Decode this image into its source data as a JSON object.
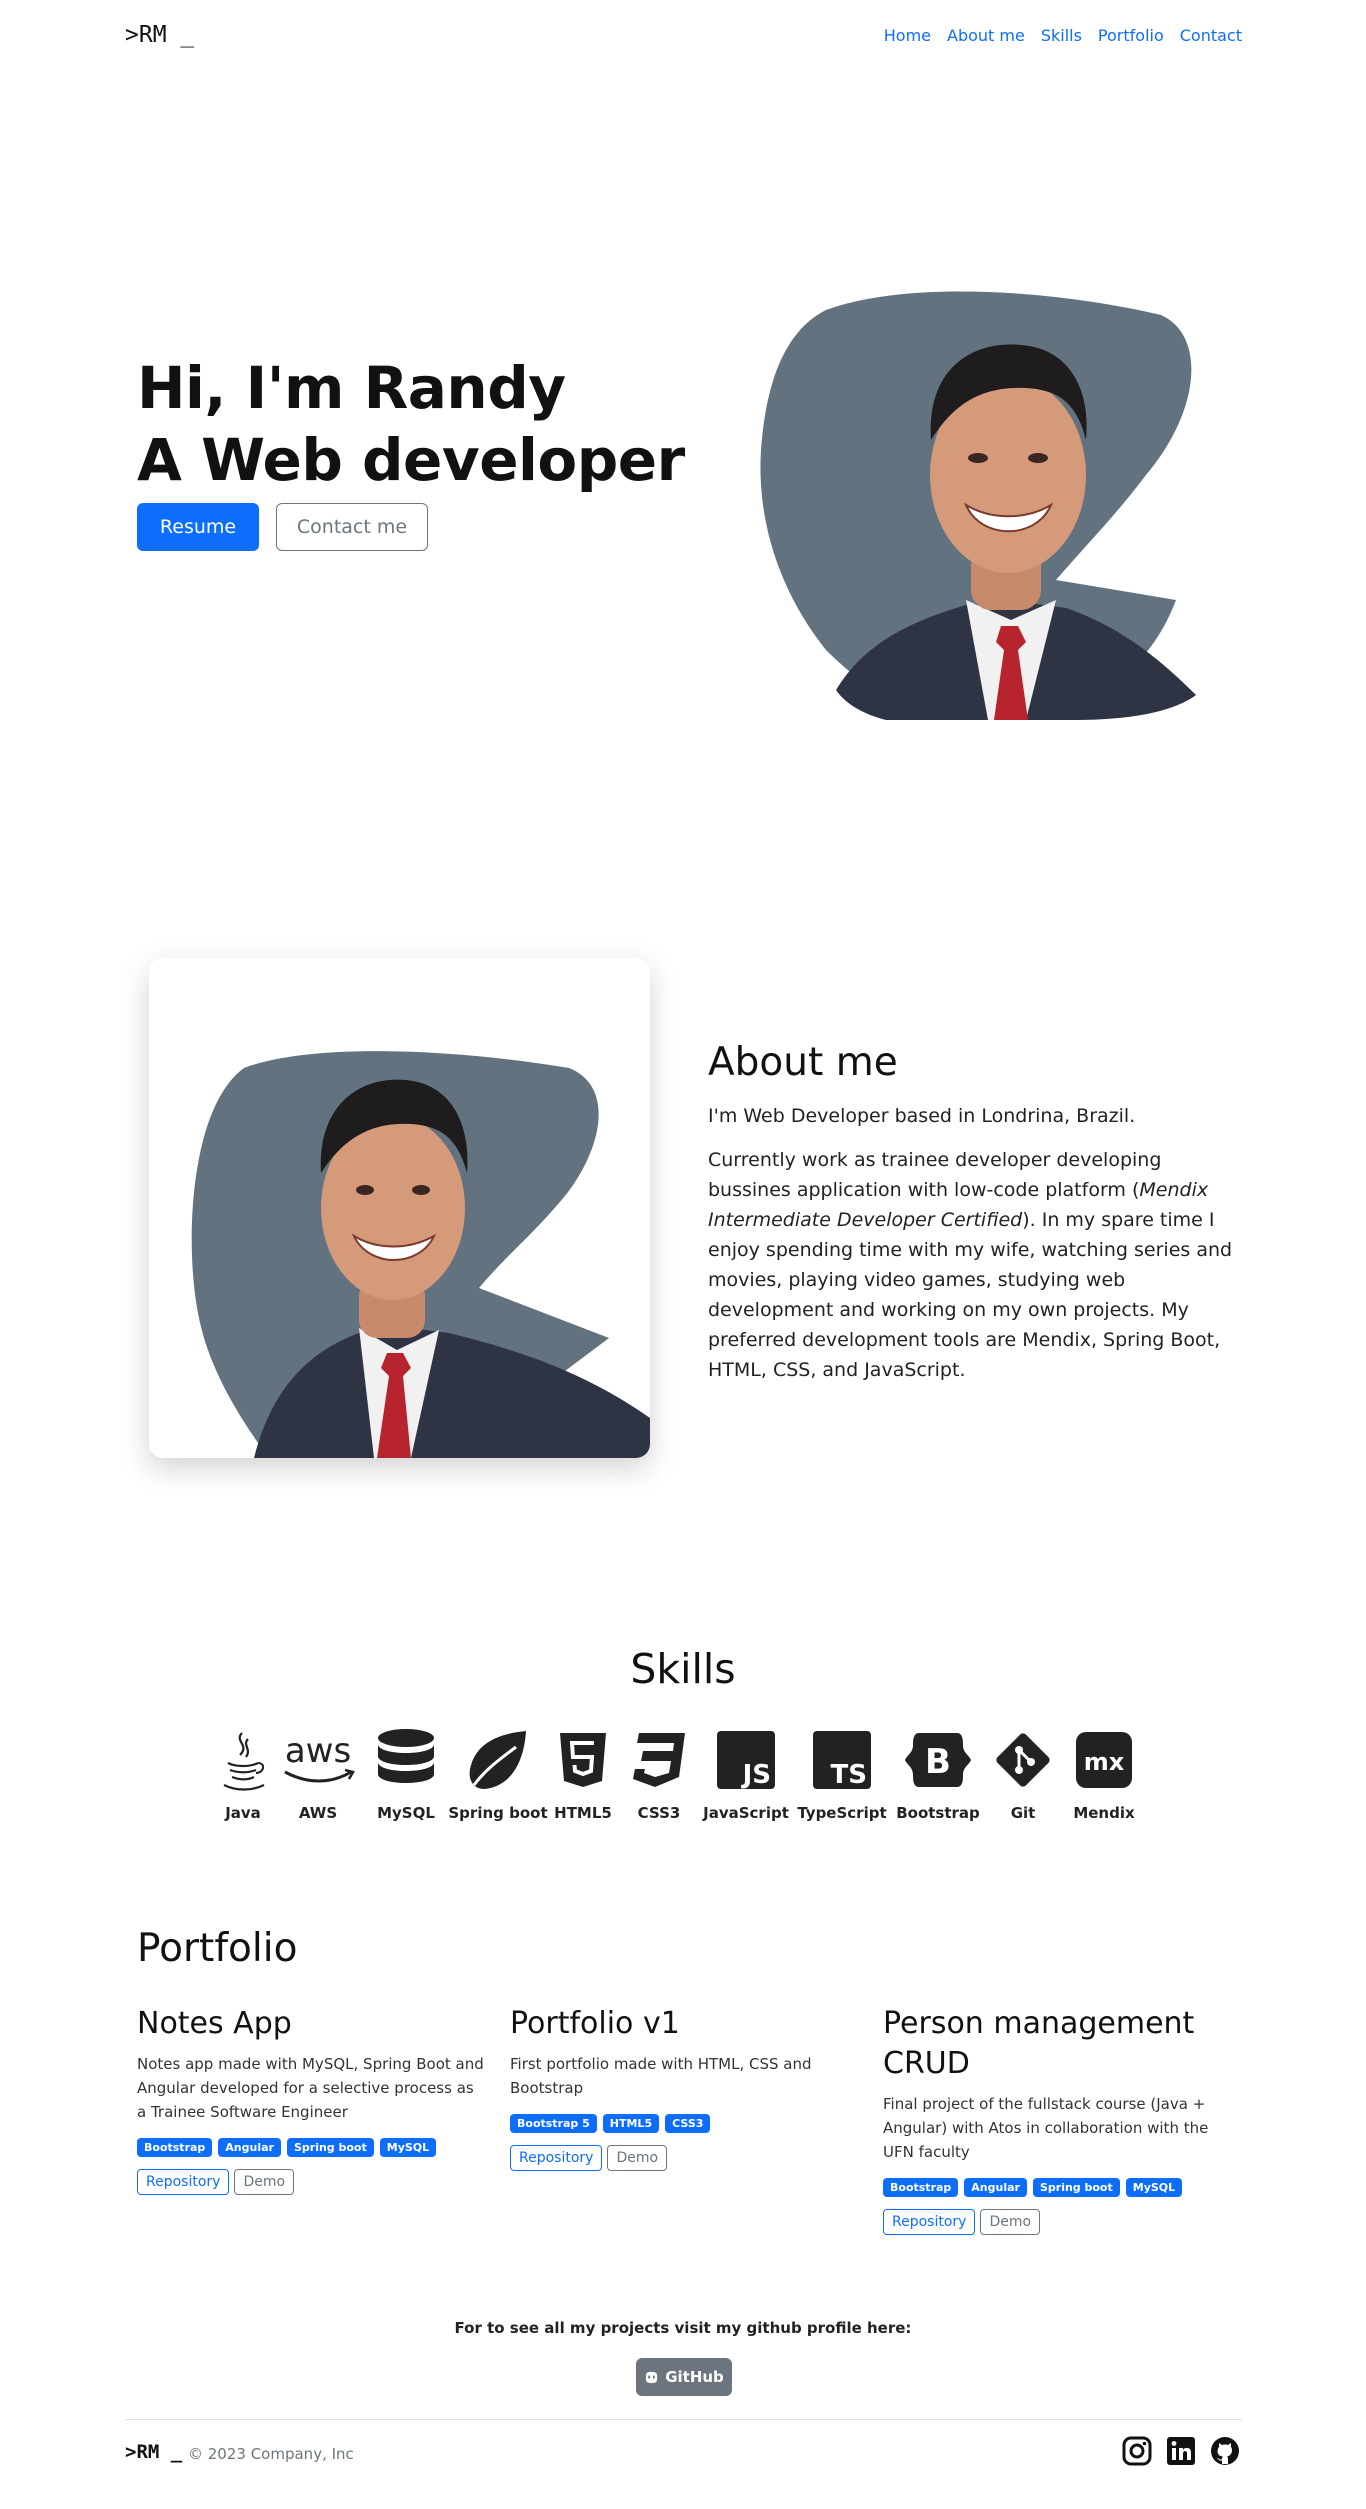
{
  "nav": {
    "brand": ">RM _",
    "links": [
      "Home",
      "About me",
      "Skills",
      "Portfolio",
      "Contact"
    ]
  },
  "hero": {
    "line1": "Hi, I'm Randy",
    "line2": "A Web developer",
    "resume_label": "Resume",
    "contact_label": "Contact me"
  },
  "about": {
    "title": "About me",
    "intro": "I'm Web Developer based in Londrina, Brazil.",
    "body_before": "Currently work as trainee developer developing bussines application with low-code platform (",
    "body_emphasis": "Mendix Intermediate Developer Certified",
    "body_after": "). In my spare time I enjoy spending time with my wife, watching series and movies, playing video games, studying web development and working on my own projects. My preferred development tools are Mendix, Spring Boot, HTML, CSS, and JavaScript."
  },
  "skills": {
    "title": "Skills",
    "items": [
      {
        "label": "Java",
        "icon": "java-icon"
      },
      {
        "label": "AWS",
        "icon": "aws-icon"
      },
      {
        "label": "MySQL",
        "icon": "database-icon"
      },
      {
        "label": "Spring boot",
        "icon": "spring-leaf-icon"
      },
      {
        "label": "HTML5",
        "icon": "html5-icon"
      },
      {
        "label": "CSS3",
        "icon": "css3-icon"
      },
      {
        "label": "JavaScript",
        "icon": "javascript-icon"
      },
      {
        "label": "TypeScript",
        "icon": "typescript-icon"
      },
      {
        "label": "Bootstrap",
        "icon": "bootstrap-icon"
      },
      {
        "label": "Git",
        "icon": "git-icon"
      },
      {
        "label": "Mendix",
        "icon": "mendix-icon"
      }
    ]
  },
  "portfolio": {
    "title": "Portfolio",
    "projects": [
      {
        "title": "Notes App",
        "description": "Notes app made with MySQL, Spring Boot and Angular developed for a selective process as a Trainee Software Engineer",
        "tags": [
          "Bootstrap",
          "Angular",
          "Spring boot",
          "MySQL"
        ],
        "repo_label": "Repository",
        "demo_label": "Demo"
      },
      {
        "title": "Portfolio v1",
        "description": "First portfolio made with HTML, CSS and Bootstrap",
        "tags": [
          "Bootstrap 5",
          "HTML5",
          "CSS3"
        ],
        "repo_label": "Repository",
        "demo_label": "Demo"
      },
      {
        "title": "Person management CRUD",
        "description": "Final project of the fullstack course (Java + Angular) with Atos in collaboration with the UFN faculty",
        "tags": [
          "Bootstrap",
          "Angular",
          "Spring boot",
          "MySQL"
        ],
        "repo_label": "Repository",
        "demo_label": "Demo"
      }
    ],
    "github_text": "For to see all my projects visit my github profile here:",
    "github_button": "GitHub"
  },
  "footer": {
    "brand": ">RM _",
    "copyright": "© 2023 Company, Inc",
    "socials": [
      "instagram-icon",
      "linkedin-icon",
      "github-icon"
    ]
  },
  "colors": {
    "primary": "#0d6efd",
    "secondary": "#6c757d",
    "portrait_bg": "#62737f",
    "text": "#212529"
  }
}
